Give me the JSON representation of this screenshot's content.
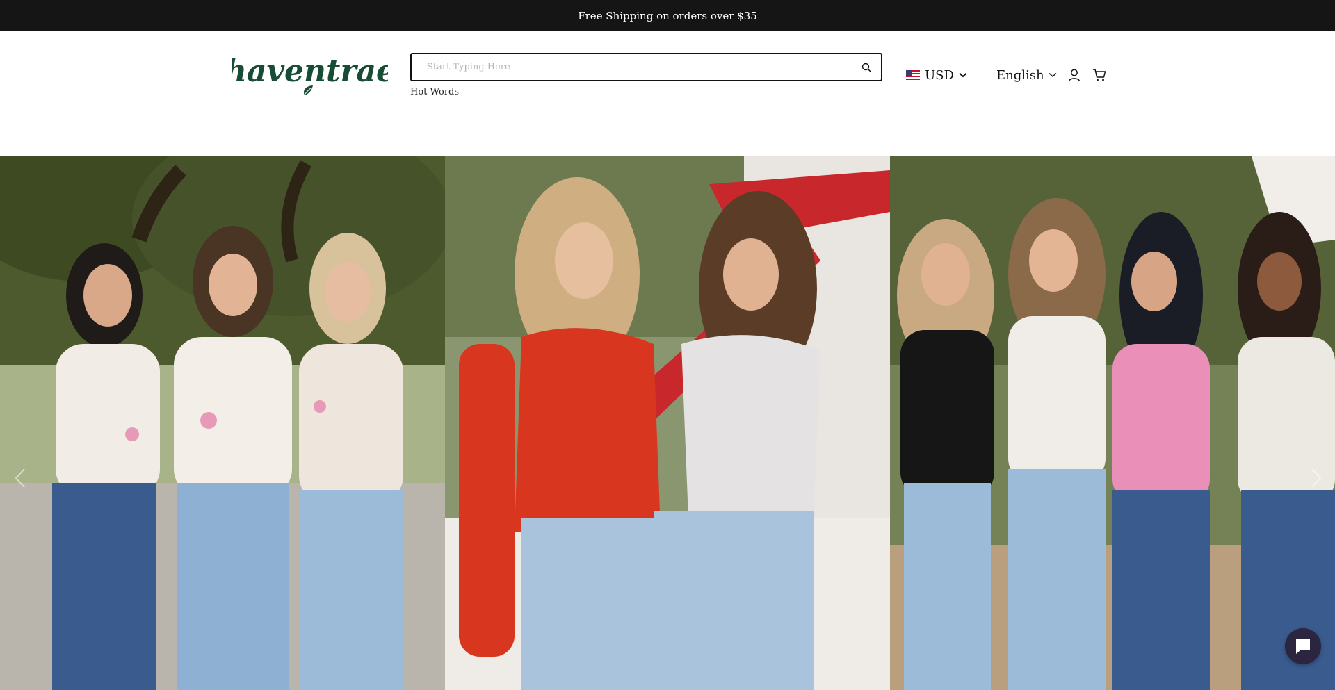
{
  "announcement": {
    "text": "Free Shipping on orders over $35"
  },
  "header": {
    "logo_text": "haventrae",
    "search": {
      "placeholder": "Start Typing Here",
      "value": ""
    },
    "hot_words_label": "Hot Words",
    "currency": {
      "code": "USD",
      "flag_icon": "us-flag-icon"
    },
    "language": {
      "label": "English"
    },
    "icons": [
      "search-icon",
      "chevron-down-icon",
      "account-icon",
      "cart-icon"
    ]
  },
  "hero": {
    "panels": [
      "group-of-three-women-in-bow-tees",
      "two-women-rhinestone-tops",
      "group-of-four-women-in-jeans"
    ],
    "nav_icons": [
      "chevron-left-icon",
      "chevron-right-icon"
    ]
  },
  "chat": {
    "icon": "chat-bubble-icon"
  },
  "colors": {
    "announcement_bg": "#151515",
    "logo_green": "#174d34",
    "chat_bg": "#2b2540"
  }
}
